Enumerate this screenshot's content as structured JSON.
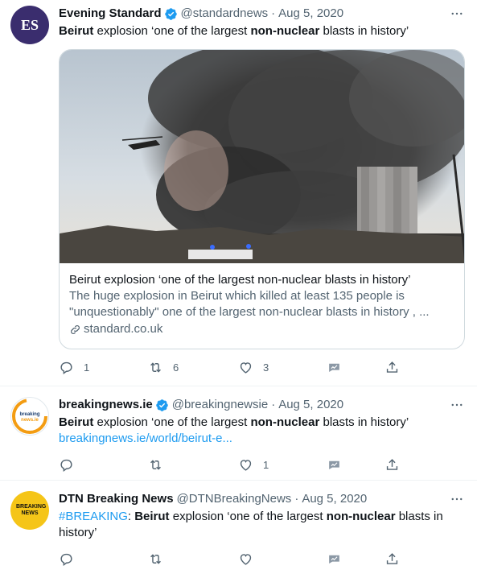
{
  "tweets": [
    {
      "name": "Evening Standard",
      "handle": "@standardnews",
      "sep": "·",
      "date": "Aug 5, 2020",
      "avatar_text": "ES",
      "text_parts": [
        {
          "t": "Beirut",
          "b": true
        },
        {
          "t": " explosion ‘one of the largest ",
          "b": false
        },
        {
          "t": "non-nuclear",
          "b": true
        },
        {
          "t": " blasts in history’",
          "b": false
        }
      ],
      "card": {
        "title": "Beirut explosion ‘one of the largest non-nuclear blasts in history’",
        "description": "The huge explosion in Beirut which killed at least 135 people is \"unquestionably\" one of the largest non-nuclear blasts in history , ...",
        "domain": "standard.co.uk"
      },
      "counts": {
        "reply": "1",
        "retweet": "6",
        "like": "3"
      }
    },
    {
      "name": "breakingnews.ie",
      "handle": "@breakingnewsie",
      "sep": "·",
      "date": "Aug 5, 2020",
      "avatar_text": "breaking news.ie",
      "text_parts": [
        {
          "t": "Beirut",
          "b": true
        },
        {
          "t": " explosion ‘one of the largest ",
          "b": false
        },
        {
          "t": "non-nuclear",
          "b": true
        },
        {
          "t": " blasts in history’",
          "b": false
        }
      ],
      "link": "breakingnews.ie/world/beirut-e...",
      "counts": {
        "reply": "",
        "retweet": "",
        "like": "1"
      }
    },
    {
      "name": "DTN Breaking News",
      "handle": "@DTNBreakingNews",
      "sep": "·",
      "date": "Aug 5, 2020",
      "avatar_text": "BREAKING NEWS",
      "hashtag": "#BREAKING",
      "text_parts": [
        {
          "t": ": ",
          "b": false
        },
        {
          "t": "Beirut",
          "b": true
        },
        {
          "t": " explosion ‘one of the largest ",
          "b": false
        },
        {
          "t": "non-nuclear",
          "b": true
        },
        {
          "t": " blasts in history’",
          "b": false
        }
      ],
      "counts": {
        "reply": "",
        "retweet": "",
        "like": ""
      }
    }
  ],
  "colors": {
    "accent": "#1d9bf0",
    "secondary_text": "#536471",
    "verified": "#1d9bf0",
    "es_avatar_bg": "#3a2d6e",
    "dtn_avatar_bg": "#f5c518"
  },
  "icons": [
    "more-icon",
    "verified-icon",
    "reply-icon",
    "retweet-icon",
    "like-icon",
    "analytics-icon",
    "share-icon",
    "link-icon"
  ]
}
